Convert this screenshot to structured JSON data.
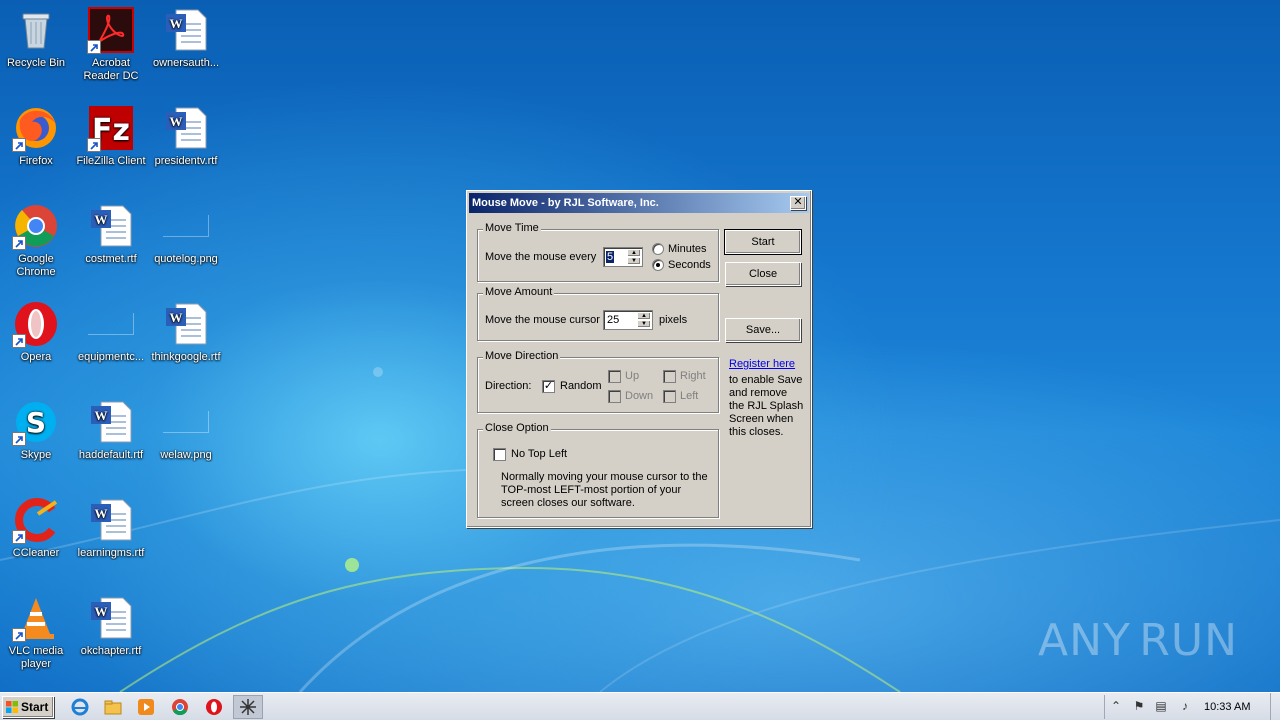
{
  "desktop": {
    "icons": [
      {
        "label": "Recycle Bin"
      },
      {
        "label": "Acrobat Reader DC"
      },
      {
        "label": "ownersauth..."
      },
      {
        "label": "Firefox"
      },
      {
        "label": "FileZilla Client"
      },
      {
        "label": "presidentv.rtf"
      },
      {
        "label": "Google Chrome"
      },
      {
        "label": "costmet.rtf"
      },
      {
        "label": "quotelog.png"
      },
      {
        "label": "Opera"
      },
      {
        "label": "equipmentc..."
      },
      {
        "label": "thinkgoogle.rtf"
      },
      {
        "label": "Skype"
      },
      {
        "label": "haddefault.rtf"
      },
      {
        "label": "welaw.png"
      },
      {
        "label": "CCleaner"
      },
      {
        "label": "learningms.rtf"
      },
      {
        "label": "VLC media player"
      },
      {
        "label": "okchapter.rtf"
      }
    ],
    "watermark_left": "ANY",
    "watermark_right": "RUN"
  },
  "dialog": {
    "title": "Mouse Move - by RJL Software, Inc.",
    "close_glyph": "✕",
    "move_time": {
      "title": "Move Time",
      "label": "Move the mouse every",
      "value": "5",
      "unit_minutes": "Minutes",
      "unit_seconds": "Seconds",
      "selected_unit": "Seconds"
    },
    "move_amount": {
      "title": "Move Amount",
      "label": "Move the mouse cursor",
      "value": "25",
      "unit": "pixels"
    },
    "move_direction": {
      "title": "Move Direction",
      "label": "Direction:",
      "random": "Random",
      "random_checked": true,
      "up": "Up",
      "down": "Down",
      "right": "Right",
      "left": "Left"
    },
    "close_option": {
      "title": "Close Option",
      "checkbox_label": "No Top Left",
      "checked": false,
      "description": "Normally moving your mouse cursor to the TOP-most LEFT-most portion of your screen closes our software."
    },
    "buttons": {
      "start": "Start",
      "close": "Close",
      "save": "Save..."
    },
    "register_link": "Register here",
    "register_text": "to enable Save and remove the RJL Splash Screen when this closes."
  },
  "taskbar": {
    "start_label": "Start",
    "pinned": [
      {
        "icon": "ie-icon"
      },
      {
        "icon": "explorer-icon"
      },
      {
        "icon": "media-player-icon"
      },
      {
        "icon": "chrome-icon"
      },
      {
        "icon": "opera-icon"
      },
      {
        "icon": "mouse-move-app-icon"
      }
    ],
    "tray": {
      "time": "10:33 AM"
    }
  }
}
